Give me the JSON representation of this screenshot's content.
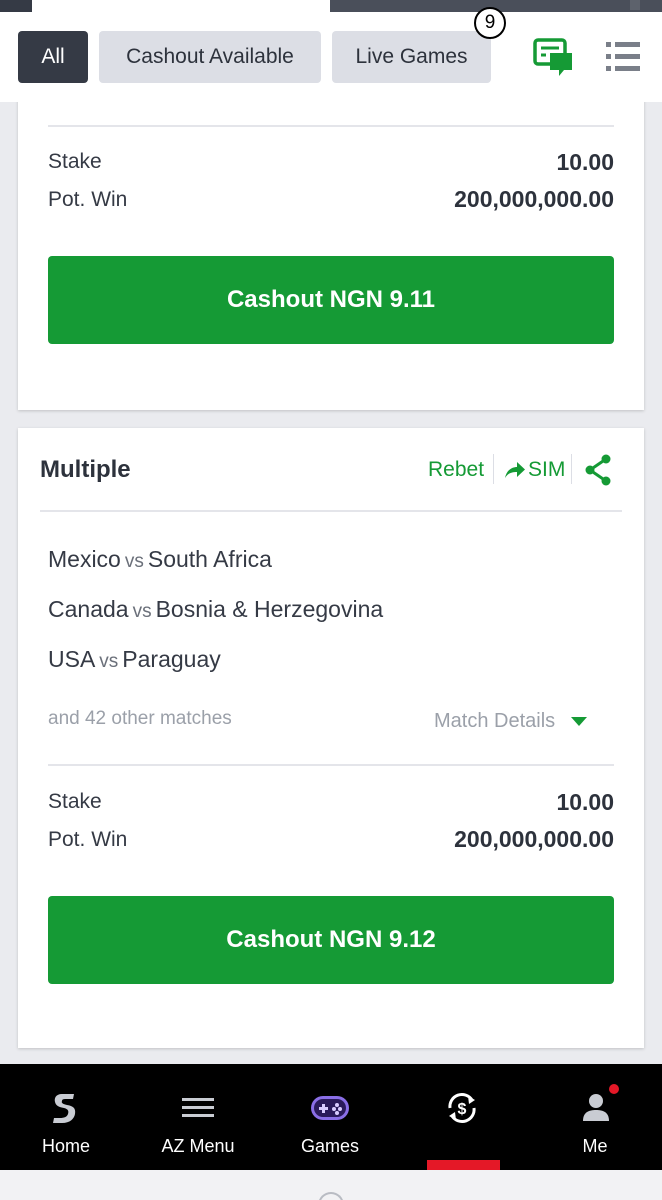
{
  "filters": {
    "all": "All",
    "cashout_available": "Cashout Available",
    "live_games": "Live Games",
    "active": "all"
  },
  "colors": {
    "brand_green": "#159a35",
    "dark": "#353a45",
    "alert_red": "#e41827"
  },
  "bet1": {
    "stake_label": "Stake",
    "stake_value": "10.00",
    "potwin_label": "Pot. Win",
    "potwin_value": "200,000,000.00",
    "cashout_label": "Cashout NGN 9.11"
  },
  "bet2": {
    "title": "Multiple",
    "rebet": "Rebet",
    "sim": "SIM",
    "matches": [
      {
        "home": "Mexico",
        "vs": "vs",
        "away": "South Africa"
      },
      {
        "home": "Canada",
        "vs": "vs",
        "away": "Bosnia & Herzegovina"
      },
      {
        "home": "USA",
        "vs": "vs",
        "away": "Paraguay"
      }
    ],
    "other_matches": "and 42 other matches",
    "match_details": "Match Details",
    "stake_label": "Stake",
    "stake_value": "10.00",
    "potwin_label": "Pot. Win",
    "potwin_value": "200,000,000.00",
    "cashout_label": "Cashout NGN 9.12"
  },
  "nav": {
    "home": "Home",
    "az_menu": "AZ Menu",
    "games": "Games",
    "cashout_badge": "9",
    "me": "Me"
  }
}
